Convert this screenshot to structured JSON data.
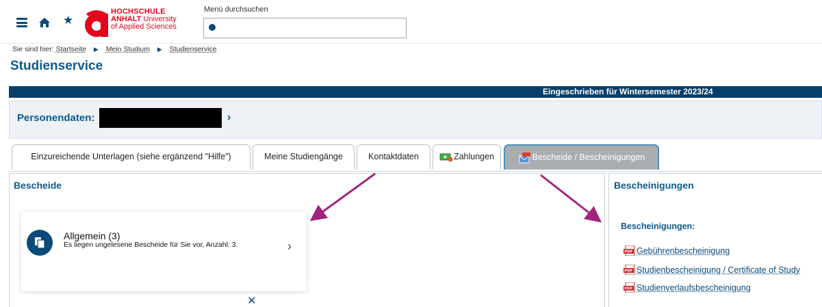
{
  "header": {
    "logo": {
      "line1": "HOCHSCHULE",
      "line2_bold": "ANHALT",
      "line2_rest": " University",
      "line3": "of Applied Sciences"
    },
    "search_label": "Menü durchsuchen",
    "search_value": ""
  },
  "breadcrumb": {
    "prefix": "Sie sind hier:",
    "items": [
      "Startseite",
      "Mein Studium",
      "Studienservice"
    ]
  },
  "page_title": "Studienservice",
  "status": "Eingeschrieben für Wintersemester 2023/24",
  "person": {
    "label": "Personendaten:"
  },
  "tabs": [
    {
      "label": "Einzureichende Unterlagen (siehe ergänzend \"Hilfe\")"
    },
    {
      "label": "Meine Studiengänge"
    },
    {
      "label": "Kontaktdaten"
    },
    {
      "label": "Zahlungen"
    },
    {
      "label": "Bescheide / Bescheinigungen"
    }
  ],
  "bescheide": {
    "title": "Bescheide",
    "card": {
      "title": "Allgemein (3)",
      "subtitle": "Es liegen ungelesene Bescheide für Sie vor, Anzahl: 3."
    }
  },
  "bescheinigungen": {
    "title": "Bescheinigungen",
    "heading": "Bescheinigungen:",
    "items": [
      "Gebührenbescheinigung",
      "Studienbescheinigung / Certificate of Study",
      "Studienverlaufsbescheinigung"
    ]
  },
  "colors": {
    "brand_blue": "#0a4a78",
    "status_bar": "#063f69",
    "logo_red": "#e3051b",
    "annotation_arrow": "#a0237e"
  }
}
